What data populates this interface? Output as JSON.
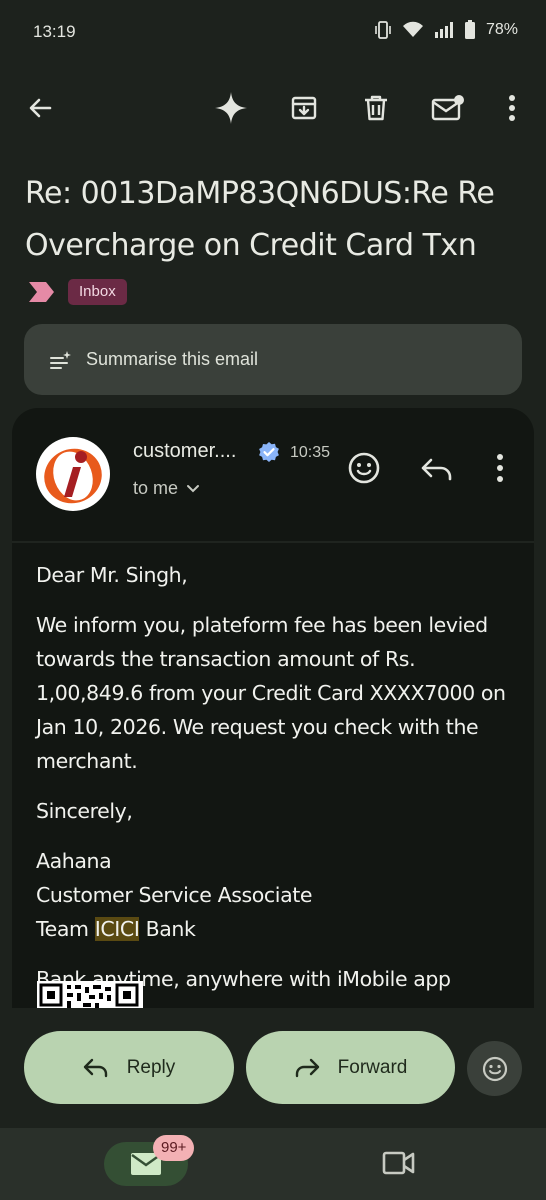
{
  "status_bar": {
    "time": "13:19",
    "battery": "78%",
    "icons": [
      "vibrate-icon",
      "wifi-icon",
      "signal-icon",
      "battery-icon"
    ]
  },
  "toolbar": {
    "icons": [
      "back-arrow-icon",
      "gemini-sparkle-icon",
      "archive-icon",
      "delete-icon",
      "mark-unread-icon",
      "more-vert-icon"
    ]
  },
  "email": {
    "subject": "Re: 0013DaMP83QN6DUS:Re Re Overcharge on Credit Card Txn",
    "label": "Inbox",
    "summarise_label": "Summarise this email"
  },
  "message": {
    "sender": "customer....",
    "time": "10:35",
    "recipient": "to me",
    "greeting": "Dear Mr. Singh,",
    "paragraph": "We inform you, plateform fee has been levied towards the transaction amount of Rs. 1,00,849.6 from your Credit Card XXXX7000 on Jan 10, 2026. We request you check with the merchant.",
    "closing": "Sincerely,",
    "signature_name": "Aahana",
    "signature_title": "Customer Service Associate",
    "signature_team_prefix": "Team ",
    "signature_team_highlight": "ICICI",
    "signature_team_suffix": " Bank",
    "tagline": "Bank anytime, anywhere with iMobile app"
  },
  "actions": {
    "reply": "Reply",
    "forward": "Forward"
  },
  "bottom_nav": {
    "badge": "99+"
  },
  "colors": {
    "background": "#1d221d",
    "card": "#121612",
    "pill": "#b9d3b0",
    "label_chip": "#6b2a45",
    "label_arrow": "#e58aa6",
    "verified": "#8ab4f8"
  }
}
